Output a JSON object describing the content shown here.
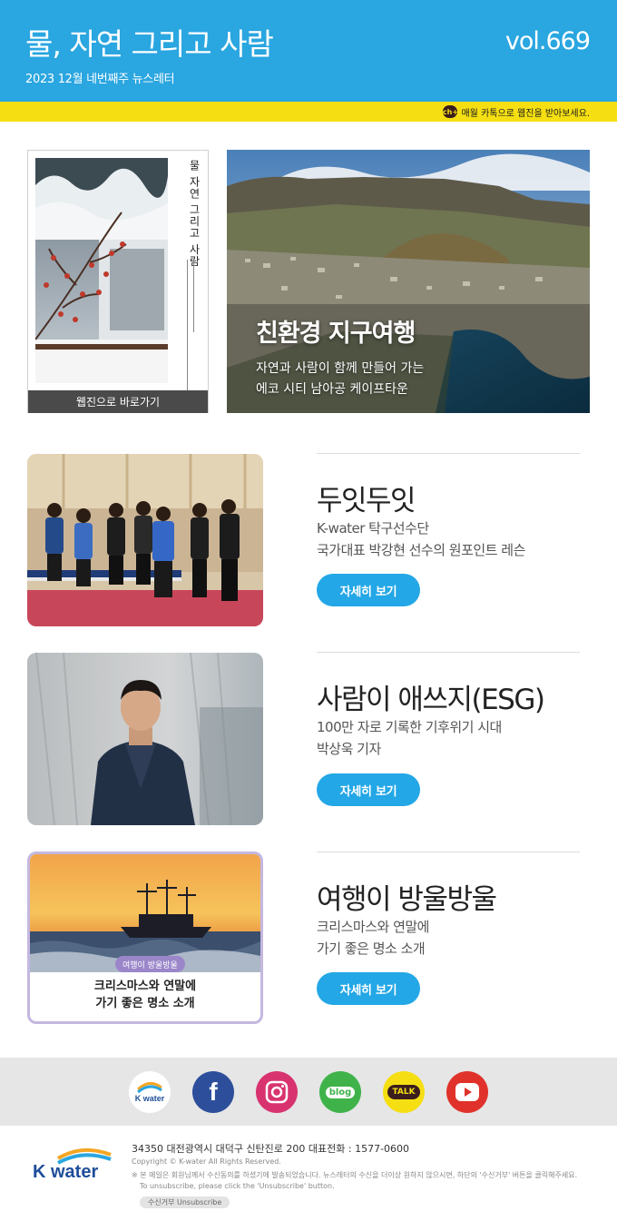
{
  "header": {
    "title": "물, 자연 그리고 사람",
    "subtitle": "2023 12월 네번째주 뉴스레터",
    "volume": "vol.669",
    "kakao_channel": "ch+",
    "kakao_notice": "매월 카톡으로 웹진을 받아보세요.",
    "accent": "#2aa6e0",
    "bar_color": "#f5df12"
  },
  "cover": {
    "vertical_title": "물 자연 그리고 사람",
    "button": "웹진으로 바로가기"
  },
  "hero": {
    "title": "친환경 지구여행",
    "desc_line1": "자연과 사람이 함께 만들어 가는",
    "desc_line2": "에코 시티 남아공 케이프타운"
  },
  "articles": [
    {
      "title": "두잇두잇",
      "desc_line1": "K-water 탁구선수단",
      "desc_line2": "국가대표 박강현 선수의 원포인트 레슨",
      "button": "자세히 보기"
    },
    {
      "title": "사람이 애쓰지(ESG)",
      "desc_line1": "100만 자로 기록한 기후위기 시대",
      "desc_line2": "박상욱 기자",
      "button": "자세히 보기"
    },
    {
      "title": "여행이 방울방울",
      "desc_line1": "크리스마스와 연말에",
      "desc_line2": "가기 좋은 명소 소개",
      "button": "자세히 보기",
      "card_badge": "여행이 방울방울",
      "card_caption": "크리스마스와 연말에\n가기 좋은 명소 소개"
    }
  ],
  "social": {
    "kwater_label": "K water",
    "facebook": "f",
    "blog": "blog",
    "talk": "TALK"
  },
  "footer": {
    "logo_text": "K water",
    "address": "34350 대전광역시 대덕구 신탄진로 200  대표전화 : 1577-0600",
    "copyright": "Copyright © K-water All Rights Reserved.",
    "notice": "※ 본 메일은 회원님께서 수신동의를 하셨기에 발송되었습니다. 뉴스레터의 수신을 더이상 원하지 않으시면, 하단의 '수신거부' 버튼을 클릭해주세요.",
    "notice_en": "To unsubscribe, please click the 'Unsubscribe' button.",
    "unsubscribe": "수신거부  Unsubscribe"
  }
}
